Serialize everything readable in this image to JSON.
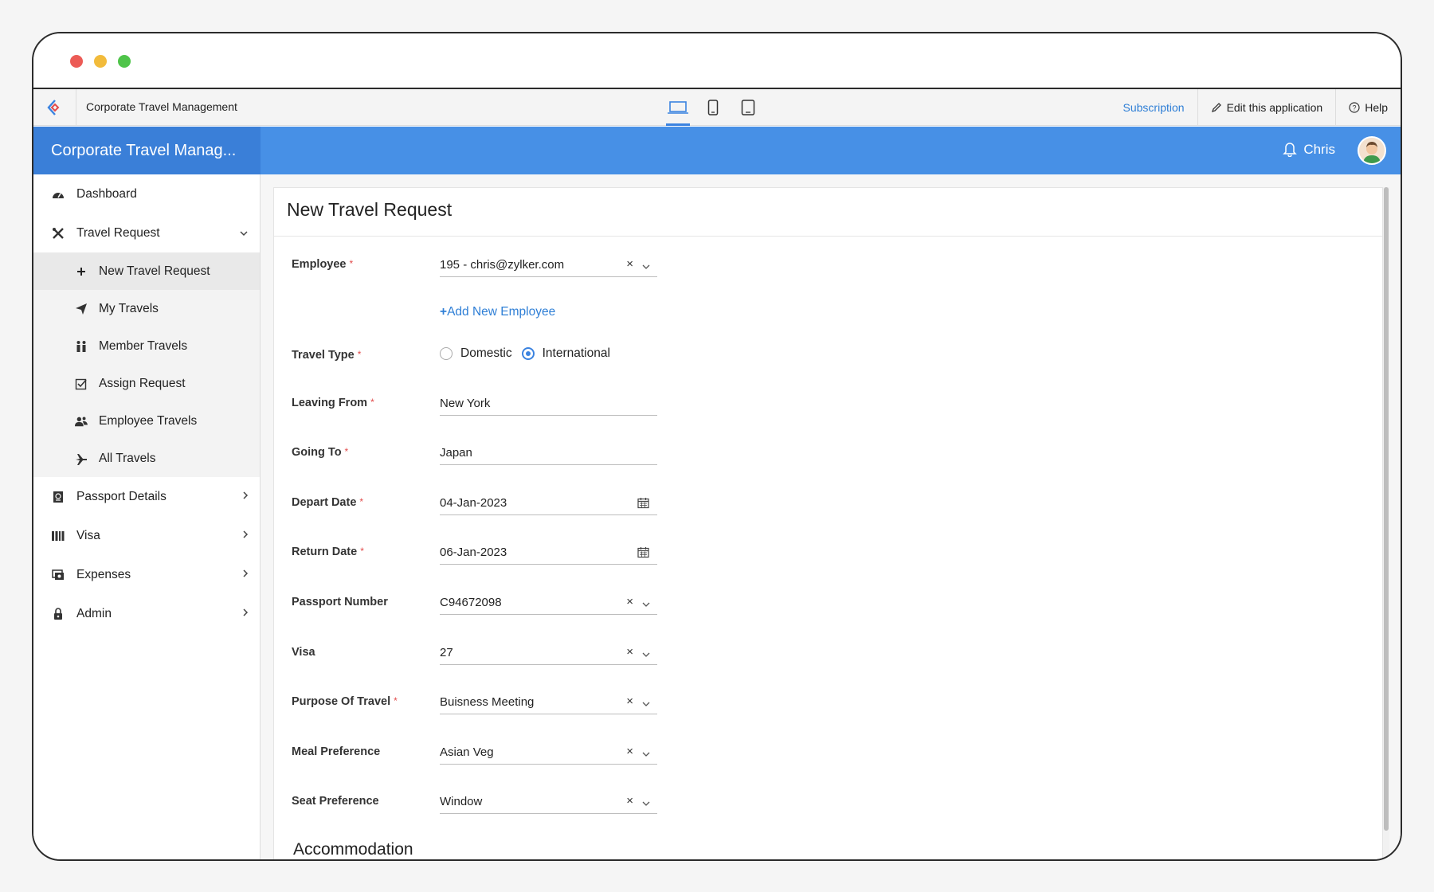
{
  "app": {
    "name": "Corporate Travel Management",
    "brand_title": "Corporate Travel Manag...",
    "user_name": "Chris"
  },
  "topbar": {
    "subscription": "Subscription",
    "edit_app": "Edit this application",
    "help": "Help"
  },
  "sidebar": {
    "items": [
      {
        "label": "Dashboard",
        "icon": "dashboard-icon"
      },
      {
        "label": "Travel Request",
        "icon": "travel-request-icon",
        "expanded": true
      },
      {
        "label": "Passport Details",
        "icon": "passport-icon"
      },
      {
        "label": "Visa",
        "icon": "visa-icon"
      },
      {
        "label": "Expenses",
        "icon": "expenses-icon"
      },
      {
        "label": "Admin",
        "icon": "admin-icon"
      }
    ],
    "sub_items": [
      {
        "label": "New Travel Request",
        "icon": "plus-icon",
        "active": true
      },
      {
        "label": "My Travels",
        "icon": "paper-plane-icon"
      },
      {
        "label": "Member Travels",
        "icon": "members-icon"
      },
      {
        "label": "Assign Request",
        "icon": "checkbox-icon"
      },
      {
        "label": "Employee Travels",
        "icon": "users-icon"
      },
      {
        "label": "All Travels",
        "icon": "plane-icon"
      }
    ]
  },
  "form": {
    "title": "New Travel Request",
    "add_employee": "Add New Employee",
    "fields": {
      "employee": {
        "label": "Employee",
        "value": "195 - chris@zylker.com"
      },
      "travel_type": {
        "label": "Travel Type",
        "options": [
          "Domestic",
          "International"
        ],
        "selected": "International"
      },
      "leaving_from": {
        "label": "Leaving From",
        "value": "New York"
      },
      "going_to": {
        "label": "Going To",
        "value": "Japan"
      },
      "depart_date": {
        "label": "Depart Date",
        "value": "04-Jan-2023"
      },
      "return_date": {
        "label": "Return Date",
        "value": "06-Jan-2023"
      },
      "passport_number": {
        "label": "Passport Number",
        "value": "C94672098"
      },
      "visa": {
        "label": "Visa",
        "value": "27"
      },
      "purpose": {
        "label": "Purpose Of Travel",
        "value": "Buisness Meeting"
      },
      "meal": {
        "label": "Meal Preference",
        "value": "Asian Veg"
      },
      "seat": {
        "label": "Seat Preference",
        "value": "Window"
      }
    },
    "required_mark": "*",
    "clear_mark": "×",
    "add_mark": "+",
    "next_section": "Accommodation"
  },
  "colors": {
    "accent": "#4790e6",
    "brand": "#3a7fd8",
    "link": "#2f7fd6",
    "required": "#e24b4b"
  }
}
